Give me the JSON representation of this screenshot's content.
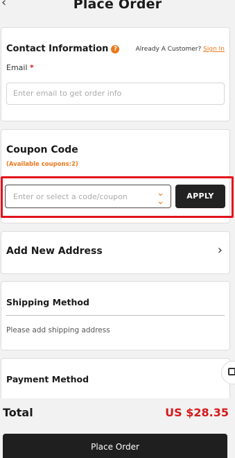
{
  "header": {
    "back_icon": "chevron-left-icon",
    "title": "Place Order"
  },
  "contact": {
    "title": "Contact Information",
    "help_icon": "help-icon",
    "already_text": "Already A Customer?",
    "sign_in": "Sign In",
    "email_label": "Email",
    "email_required": "*",
    "email_placeholder": "Enter email to get order info"
  },
  "coupon": {
    "title": "Coupon Code",
    "available": "(Available coupons:2)",
    "input_placeholder": "Enter or select a code/coupon",
    "chevron_icon": "double-chevron-down-icon",
    "apply_label": "APPLY"
  },
  "address": {
    "title": "Add New Address",
    "chevron_icon": "chevron-right-icon"
  },
  "shipping": {
    "title": "Shipping Method",
    "empty_text": "Please add shipping address"
  },
  "payment": {
    "title": "Payment Method"
  },
  "summary": {
    "total_label": "Total",
    "total_value": "US $28.35"
  },
  "footer": {
    "place_order_label": "Place Order"
  },
  "colors": {
    "accent": "#e9791c",
    "price": "#d51a1a",
    "highlight": "#e3111b",
    "button": "#222222"
  }
}
